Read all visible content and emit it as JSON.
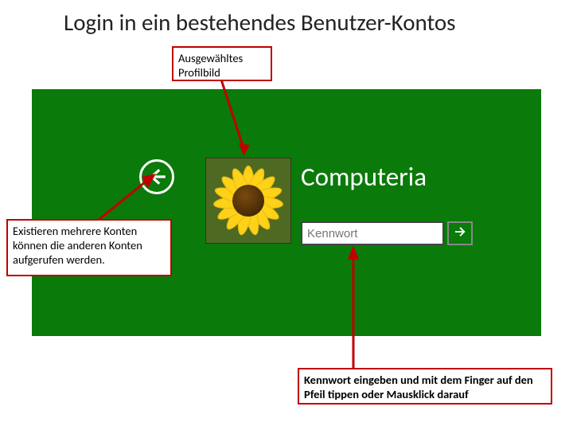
{
  "title": "Login in ein bestehendes Benutzer-Kontos",
  "login": {
    "username": "Computeria",
    "password_placeholder": "Kennwort"
  },
  "callouts": {
    "top": "Ausgewähltes Profilbild",
    "left": "Existieren mehrere Konten können die anderen Konten aufgerufen werden.",
    "bottom": "Kennwort eingeben und mit dem Finger auf den Pfeil tippen oder Mausklick darauf"
  }
}
